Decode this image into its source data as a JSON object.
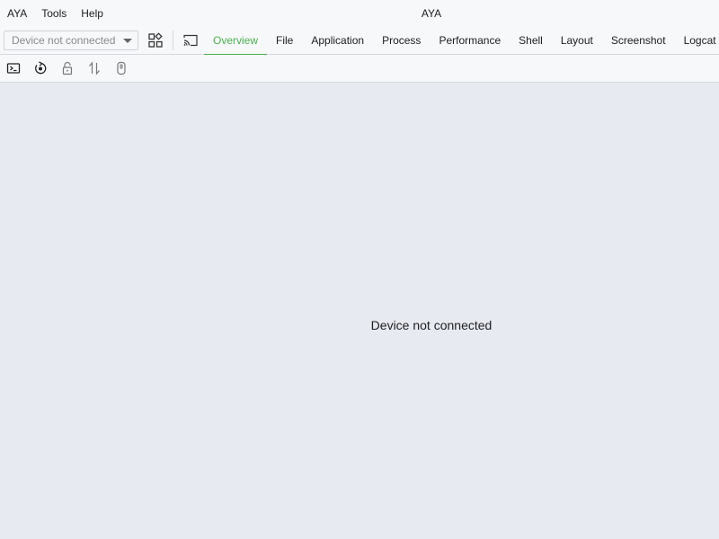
{
  "window": {
    "title": "AYA"
  },
  "menu": {
    "items": [
      {
        "label": "AYA"
      },
      {
        "label": "Tools"
      },
      {
        "label": "Help"
      }
    ]
  },
  "toolbar": {
    "device_select": {
      "value": "Device not connected"
    },
    "buttons": [
      {
        "icon": "apps-icon"
      },
      {
        "icon": "cast-icon"
      }
    ]
  },
  "tabs": [
    {
      "label": "Overview",
      "active": true
    },
    {
      "label": "File"
    },
    {
      "label": "Application"
    },
    {
      "label": "Process"
    },
    {
      "label": "Performance"
    },
    {
      "label": "Shell"
    },
    {
      "label": "Layout"
    },
    {
      "label": "Screenshot"
    },
    {
      "label": "Logcat"
    }
  ],
  "subtoolbar": {
    "buttons": [
      {
        "icon": "terminal-icon"
      },
      {
        "icon": "reboot-icon"
      },
      {
        "icon": "unlock-icon"
      },
      {
        "icon": "swap-vertical-icon"
      },
      {
        "icon": "mouse-icon"
      }
    ]
  },
  "main": {
    "empty_message": "Device not connected"
  },
  "colors": {
    "accent": "#4caf50",
    "background": "#e8eaf2",
    "toolbar": "#f7f8fa"
  }
}
